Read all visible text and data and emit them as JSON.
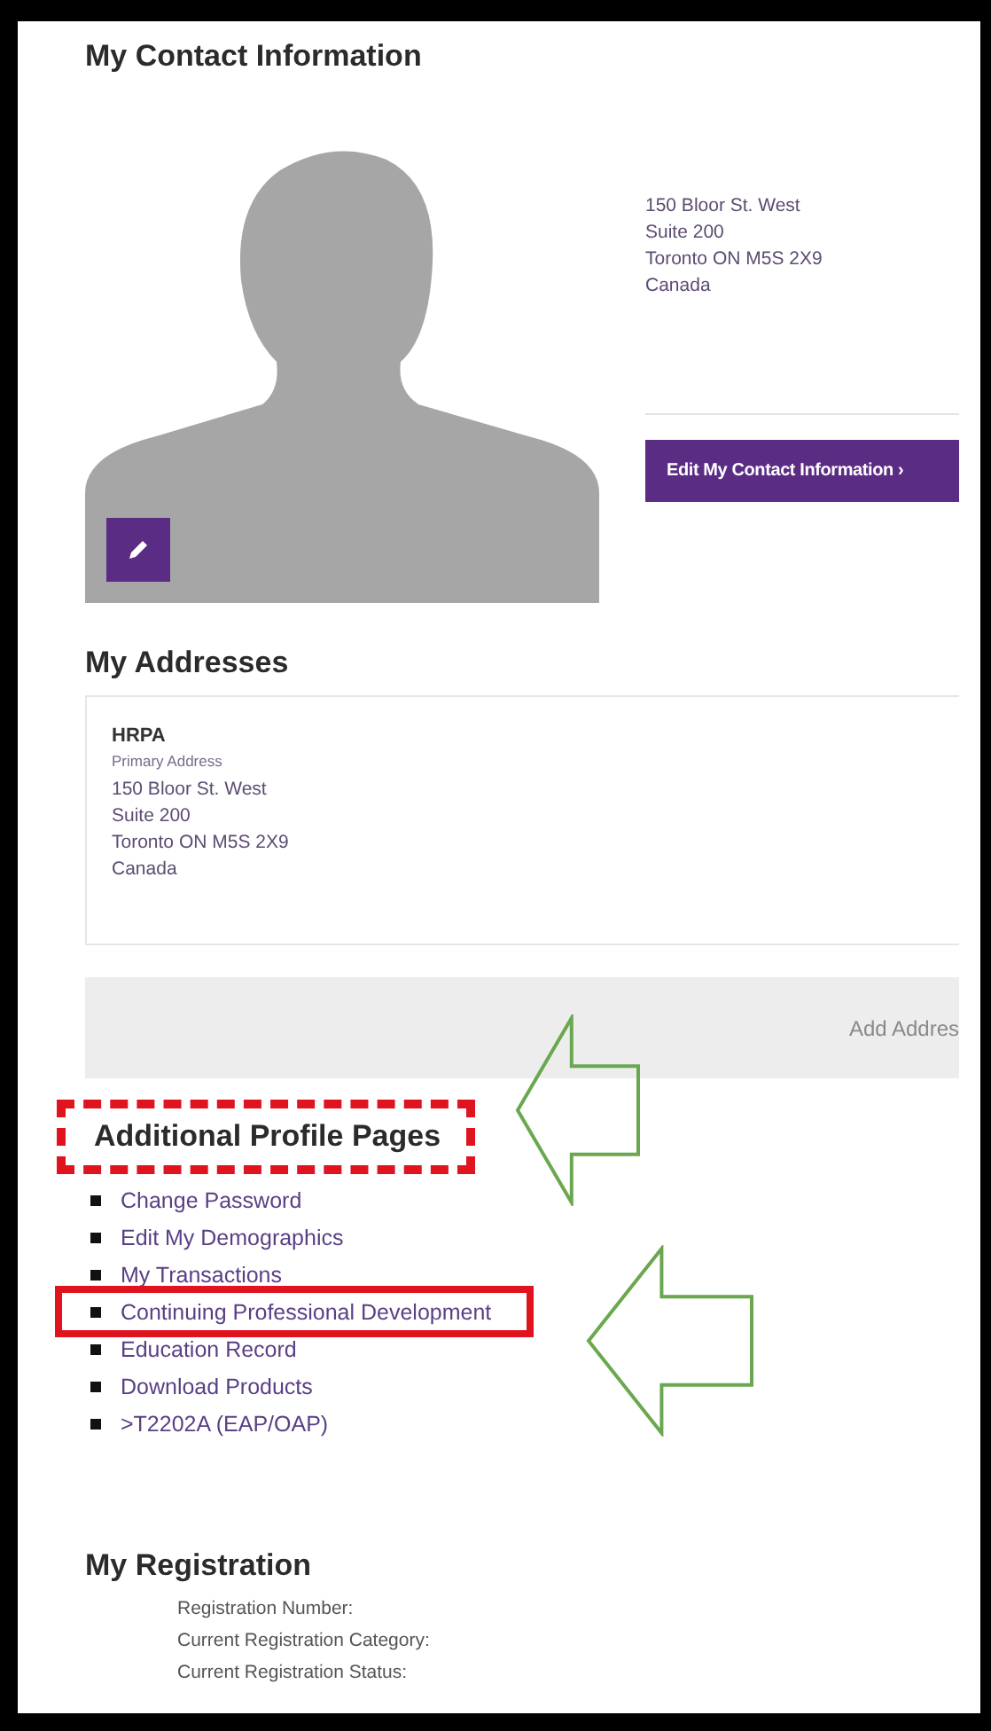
{
  "contact": {
    "heading": "My Contact Information",
    "address_lines": [
      "150 Bloor St. West",
      "Suite 200",
      "Toronto ON M5S 2X9",
      "Canada"
    ],
    "edit_button": "Edit My Contact Information ›"
  },
  "addresses": {
    "heading": "My Addresses",
    "cards": [
      {
        "name": "HRPA",
        "type": "Primary Address",
        "lines": [
          "150 Bloor St. West",
          "Suite 200",
          "Toronto ON M5S 2X9",
          "Canada"
        ]
      }
    ],
    "add_button": "Add Addres"
  },
  "additional_profile_pages": {
    "heading": "Additional Profile Pages",
    "heading_highlighted": true,
    "links": [
      {
        "label": "Change Password",
        "highlighted": false
      },
      {
        "label": "Edit My Demographics",
        "highlighted": false
      },
      {
        "label": "My Transactions",
        "highlighted": false
      },
      {
        "label": "Continuing Professional Development",
        "highlighted": true
      },
      {
        "label": "Education Record",
        "highlighted": false
      },
      {
        "label": "Download Products",
        "highlighted": false
      },
      {
        "label": ">T2202A (EAP/OAP)",
        "highlighted": false
      }
    ]
  },
  "registration": {
    "heading": "My Registration",
    "fields": [
      "Registration Number:",
      "Current Registration Category:",
      "Current Registration Status:"
    ]
  }
}
